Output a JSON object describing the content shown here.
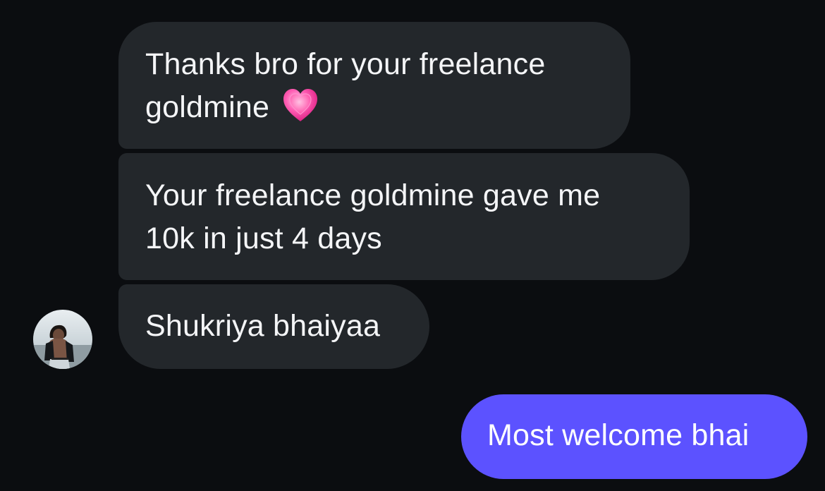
{
  "messages": [
    {
      "sender": "other",
      "text_line1": "Thanks bro for your freelance",
      "text_line2": "goldmine",
      "emoji": "growing-heart-icon"
    },
    {
      "sender": "other",
      "text_line1": "Your freelance goldmine gave me",
      "text_line2": "10k in just 4 days"
    },
    {
      "sender": "other",
      "text": "Shukriya bhaiyaa"
    },
    {
      "sender": "me",
      "text": "Most welcome bhai"
    }
  ],
  "colors": {
    "background": "#0b0d10",
    "incoming_bubble": "#23272b",
    "outgoing_bubble": "#5c52ff",
    "text": "#f4f5f7"
  }
}
